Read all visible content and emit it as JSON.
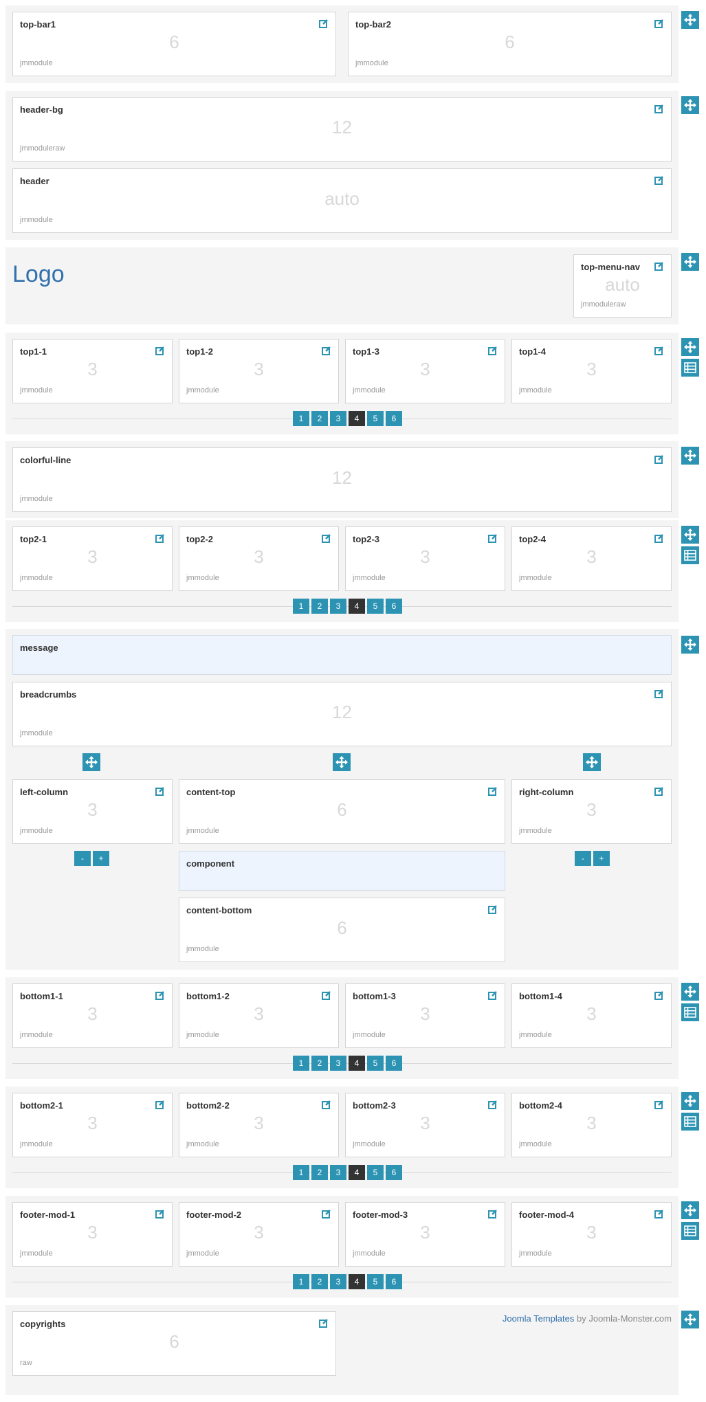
{
  "top_bar": {
    "modules": [
      {
        "name": "top-bar1",
        "size": "6",
        "type": "jmmodule"
      },
      {
        "name": "top-bar2",
        "size": "6",
        "type": "jmmodule"
      }
    ]
  },
  "header_section": {
    "modules": [
      {
        "name": "header-bg",
        "size": "12",
        "type": "jmmoduleraw"
      },
      {
        "name": "header",
        "size": "auto",
        "type": "jmmodule"
      }
    ]
  },
  "logo_section": {
    "logo": "Logo",
    "module": {
      "name": "top-menu-nav",
      "size": "auto",
      "type": "jmmoduleraw"
    }
  },
  "top1": {
    "modules": [
      {
        "name": "top1-1",
        "size": "3",
        "type": "jmmodule"
      },
      {
        "name": "top1-2",
        "size": "3",
        "type": "jmmodule"
      },
      {
        "name": "top1-3",
        "size": "3",
        "type": "jmmodule"
      },
      {
        "name": "top1-4",
        "size": "3",
        "type": "jmmodule"
      }
    ]
  },
  "colorful": {
    "module": {
      "name": "colorful-line",
      "size": "12",
      "type": "jmmodule"
    }
  },
  "top2": {
    "modules": [
      {
        "name": "top2-1",
        "size": "3",
        "type": "jmmodule"
      },
      {
        "name": "top2-2",
        "size": "3",
        "type": "jmmodule"
      },
      {
        "name": "top2-3",
        "size": "3",
        "type": "jmmodule"
      },
      {
        "name": "top2-4",
        "size": "3",
        "type": "jmmodule"
      }
    ]
  },
  "main": {
    "message": "message",
    "breadcrumbs": {
      "name": "breadcrumbs",
      "size": "12",
      "type": "jmmodule"
    },
    "left": {
      "name": "left-column",
      "size": "3",
      "type": "jmmodule"
    },
    "content_top": {
      "name": "content-top",
      "size": "6",
      "type": "jmmodule"
    },
    "right": {
      "name": "right-column",
      "size": "3",
      "type": "jmmodule"
    },
    "component": "component",
    "content_bottom": {
      "name": "content-bottom",
      "size": "6",
      "type": "jmmodule"
    },
    "minus": "-",
    "plus": "+"
  },
  "bottom1": {
    "modules": [
      {
        "name": "bottom1-1",
        "size": "3",
        "type": "jmmodule"
      },
      {
        "name": "bottom1-2",
        "size": "3",
        "type": "jmmodule"
      },
      {
        "name": "bottom1-3",
        "size": "3",
        "type": "jmmodule"
      },
      {
        "name": "bottom1-4",
        "size": "3",
        "type": "jmmodule"
      }
    ]
  },
  "bottom2": {
    "modules": [
      {
        "name": "bottom2-1",
        "size": "3",
        "type": "jmmodule"
      },
      {
        "name": "bottom2-2",
        "size": "3",
        "type": "jmmodule"
      },
      {
        "name": "bottom2-3",
        "size": "3",
        "type": "jmmodule"
      },
      {
        "name": "bottom2-4",
        "size": "3",
        "type": "jmmodule"
      }
    ]
  },
  "footer": {
    "modules": [
      {
        "name": "footer-mod-1",
        "size": "3",
        "type": "jmmodule"
      },
      {
        "name": "footer-mod-2",
        "size": "3",
        "type": "jmmodule"
      },
      {
        "name": "footer-mod-3",
        "size": "3",
        "type": "jmmodule"
      },
      {
        "name": "footer-mod-4",
        "size": "3",
        "type": "jmmodule"
      }
    ]
  },
  "copyright": {
    "module": {
      "name": "copyrights",
      "size": "6",
      "type": "raw"
    },
    "credit_link": "Joomla Templates",
    "credit_rest": " by Joomla-Monster.com"
  },
  "pager": {
    "labels": [
      "1",
      "2",
      "3",
      "4",
      "5",
      "6"
    ],
    "active": "4"
  },
  "icons": {
    "edit": "edit-icon",
    "move": "move-icon",
    "list": "list-icon"
  },
  "colors": {
    "accent": "#2c93b3",
    "active": "#333333",
    "section_bg": "#f4f4f4",
    "logo": "#3271ac",
    "message_bg": "#edf4fd"
  }
}
